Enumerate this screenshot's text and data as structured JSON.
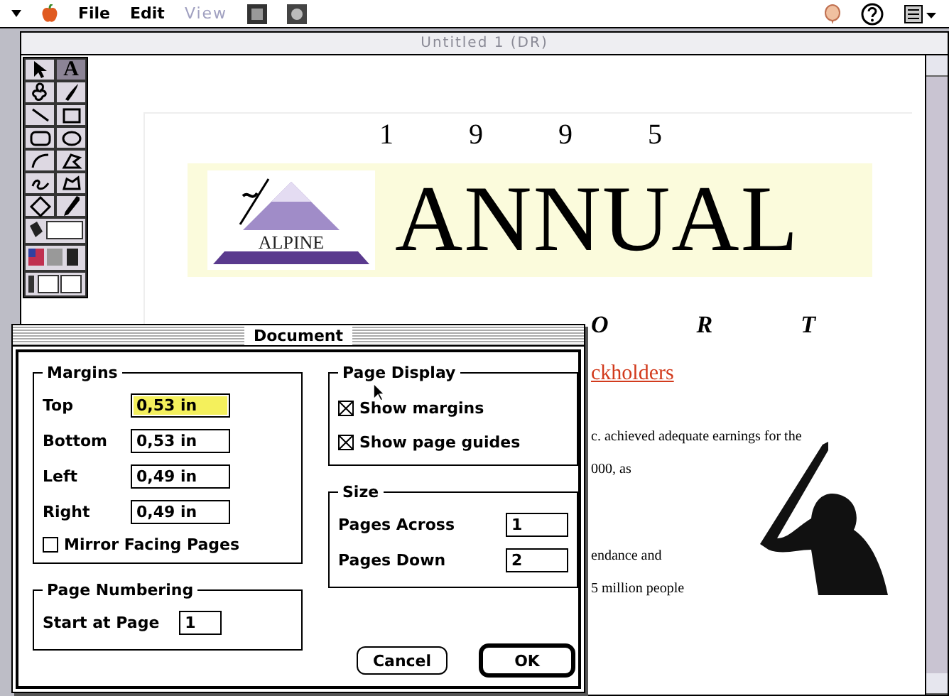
{
  "menu_bar": {
    "items": [
      {
        "label": "File",
        "disabled": false
      },
      {
        "label": "Edit",
        "disabled": false
      },
      {
        "label": "View",
        "disabled": true
      }
    ]
  },
  "window": {
    "title": "Untitled 1 (DR)"
  },
  "tools": [
    {
      "kind": "pointer",
      "selected": false
    },
    {
      "kind": "text",
      "label": "A",
      "selected": true
    },
    {
      "kind": "blob",
      "selected": false
    },
    {
      "kind": "brush",
      "selected": false
    },
    {
      "kind": "line",
      "selected": false
    },
    {
      "kind": "rect",
      "selected": false
    },
    {
      "kind": "roundrect",
      "selected": false
    },
    {
      "kind": "oval",
      "selected": false
    },
    {
      "kind": "arc",
      "selected": false
    },
    {
      "kind": "polygon",
      "selected": false
    },
    {
      "kind": "freehand",
      "selected": false
    },
    {
      "kind": "freeshape",
      "selected": false
    },
    {
      "kind": "diamond",
      "selected": false
    },
    {
      "kind": "eyedropper",
      "selected": false
    }
  ],
  "document": {
    "year_digits": [
      "1",
      "9",
      "9",
      "5"
    ],
    "logo": "ALPINE",
    "headline": "ANNUAL",
    "subtitle_letters": [
      "O",
      "R",
      "T"
    ],
    "link": "ckholders",
    "paragraphs": [
      [
        "c. achieved adequate earnings for the",
        "000, as"
      ],
      [
        "endance and",
        "5 million people"
      ]
    ]
  },
  "dialog": {
    "title": "Document",
    "margins": {
      "title": "Margins",
      "fields": [
        {
          "label": "Top",
          "value": "0,53 in",
          "selected": true
        },
        {
          "label": "Bottom",
          "value": "0,53 in",
          "selected": false
        },
        {
          "label": "Left",
          "value": "0,49 in",
          "selected": false
        },
        {
          "label": "Right",
          "value": "0,49 in",
          "selected": false
        }
      ],
      "mirror": {
        "label": "Mirror Facing Pages",
        "checked": false
      }
    },
    "page_display": {
      "title": "Page Display",
      "options": [
        {
          "label": "Show margins",
          "checked": true
        },
        {
          "label": "Show page guides",
          "checked": true
        }
      ]
    },
    "size": {
      "title": "Size",
      "fields": [
        {
          "label": "Pages Across",
          "value": "1"
        },
        {
          "label": "Pages Down",
          "value": "2"
        }
      ]
    },
    "page_numbering": {
      "title": "Page Numbering",
      "label": "Start at Page",
      "value": "1"
    },
    "buttons": [
      {
        "label": "Cancel",
        "default": false
      },
      {
        "label": "OK",
        "default": true
      }
    ]
  }
}
